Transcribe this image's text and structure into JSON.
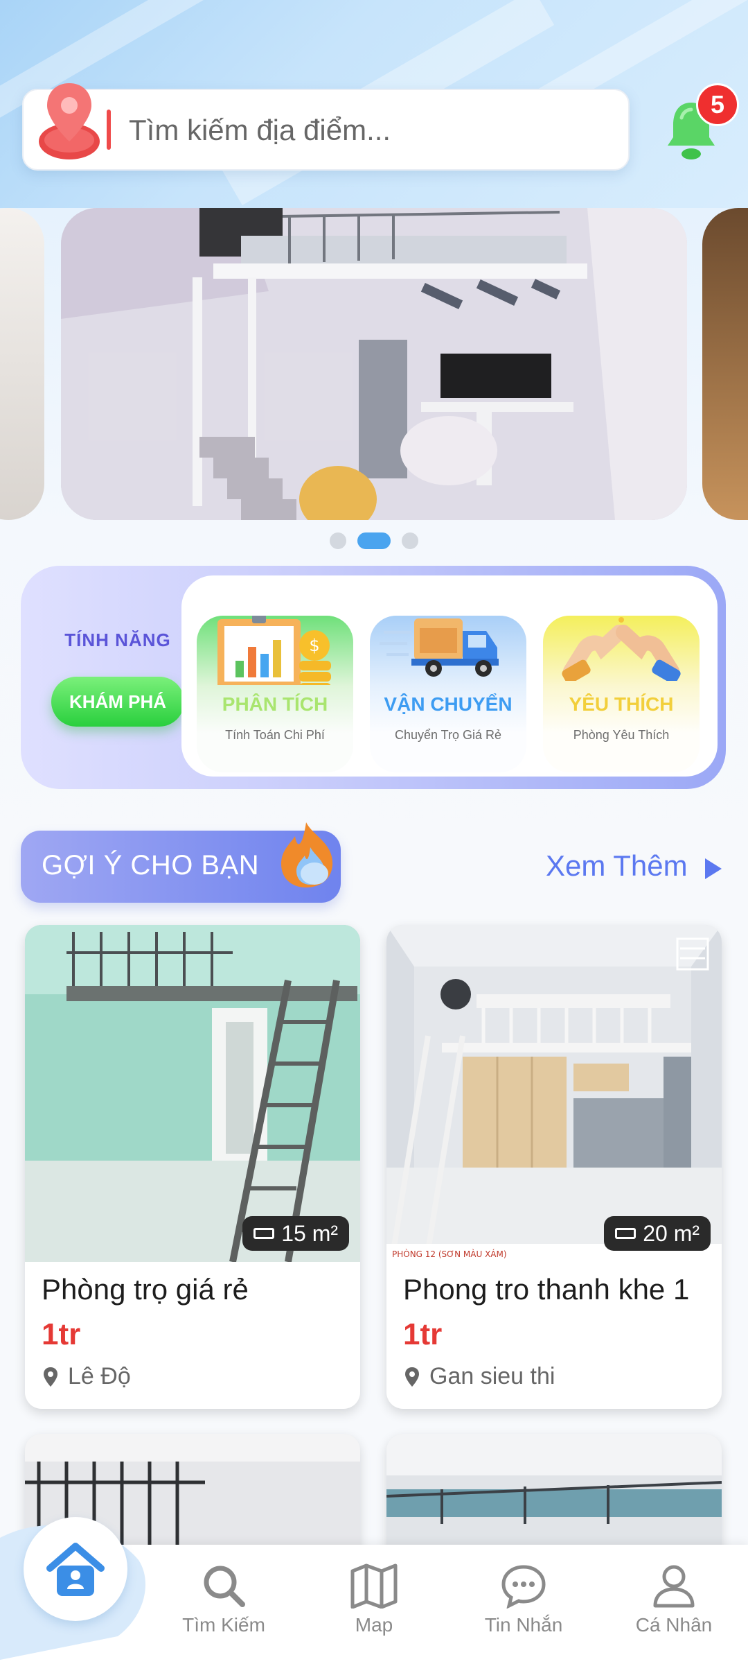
{
  "search": {
    "placeholder": "Tìm kiếm địa điểm..."
  },
  "notifications": {
    "count": "5"
  },
  "carousel": {
    "slide_count": 3,
    "active_index": 1
  },
  "features": {
    "label": "TÍNH NĂNG",
    "explore_button": "KHÁM PHÁ",
    "cards": [
      {
        "title": "PHÂN TÍCH",
        "subtitle": "Tính Toán Chi Phí",
        "color": "#a9e56f"
      },
      {
        "title": "VẬN CHUYỂN",
        "subtitle": "Chuyển Trọ Giá Rẻ",
        "color": "#3d9cf2"
      },
      {
        "title": "YÊU THÍCH",
        "subtitle": "Phòng Yêu Thích",
        "color": "#f2cf3b"
      }
    ]
  },
  "suggest": {
    "title": "GỢI Ý CHO BẠN",
    "more": "Xem Thêm"
  },
  "listings": [
    {
      "name": "Phòng trọ giá rẻ",
      "price": "1tr",
      "location": "Lê Độ",
      "area": "15 m²"
    },
    {
      "name": "Phong tro thanh khe 1",
      "price": "1tr",
      "location": "Gan sieu thi",
      "area": "20 m²",
      "photo_caption": "PHÒNG 12 (SƠN MÀU XÁM)"
    }
  ],
  "nav": {
    "home": "",
    "search": "Tìm Kiếm",
    "map": "Map",
    "messages": "Tin Nhắn",
    "profile": "Cá Nhân"
  },
  "colors": {
    "accent": "#5b78f0",
    "price": "#e53935",
    "home_icon": "#3b8ee6"
  }
}
